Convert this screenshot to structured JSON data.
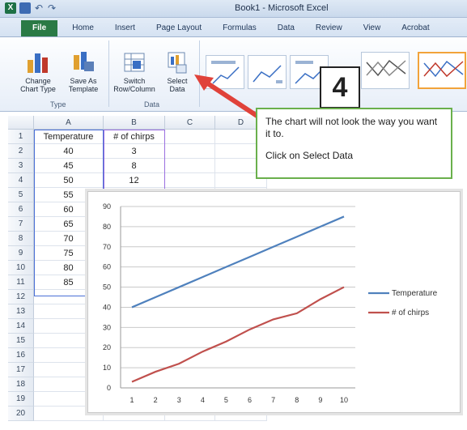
{
  "window": {
    "title": "Book1 - Microsoft Excel"
  },
  "tabs": [
    "File",
    "Home",
    "Insert",
    "Page Layout",
    "Formulas",
    "Data",
    "Review",
    "View",
    "Acrobat"
  ],
  "ribbon": {
    "change_chart_type": "Change\nChart Type",
    "save_as_template": "Save As\nTemplate",
    "group_type": "Type",
    "switch_row_column": "Switch\nRow/Column",
    "select_data": "Select\nData",
    "group_data": "Data"
  },
  "sheet": {
    "columns": [
      "A",
      "B",
      "C",
      "D"
    ],
    "rows": [
      "1",
      "2",
      "3",
      "4",
      "5",
      "6",
      "7",
      "8",
      "9",
      "10",
      "11",
      "12",
      "13",
      "14",
      "15",
      "16",
      "17",
      "18",
      "19",
      "20"
    ],
    "header_a": "Temperature",
    "header_b": "# of chirps",
    "col_a": [
      "40",
      "45",
      "50",
      "55",
      "60",
      "65",
      "70",
      "75",
      "80",
      "85"
    ],
    "col_b": [
      "3",
      "8",
      "12"
    ]
  },
  "callout": {
    "step": "4",
    "line1": "The chart will not look the way you want it to.",
    "line2": "Click on Select Data"
  },
  "colors": {
    "series1": "#4f81bd",
    "series2": "#c0504d",
    "accent": "#e0423a",
    "callout_border": "#6ab04c"
  },
  "chart_data": {
    "type": "line",
    "x": [
      1,
      2,
      3,
      4,
      5,
      6,
      7,
      8,
      9,
      10
    ],
    "series": [
      {
        "name": "Temperature",
        "values": [
          40,
          45,
          50,
          55,
          60,
          65,
          70,
          75,
          80,
          85
        ]
      },
      {
        "name": "# of chirps",
        "values": [
          3,
          8,
          12,
          18,
          23,
          29,
          34,
          37,
          44,
          50
        ]
      }
    ],
    "yticks": [
      "0",
      "10",
      "20",
      "30",
      "40",
      "50",
      "60",
      "70",
      "80",
      "90"
    ],
    "xticks": [
      "1",
      "2",
      "3",
      "4",
      "5",
      "6",
      "7",
      "8",
      "9",
      "10"
    ],
    "ylim": [
      0,
      90
    ],
    "grid": true,
    "legend": "right"
  }
}
